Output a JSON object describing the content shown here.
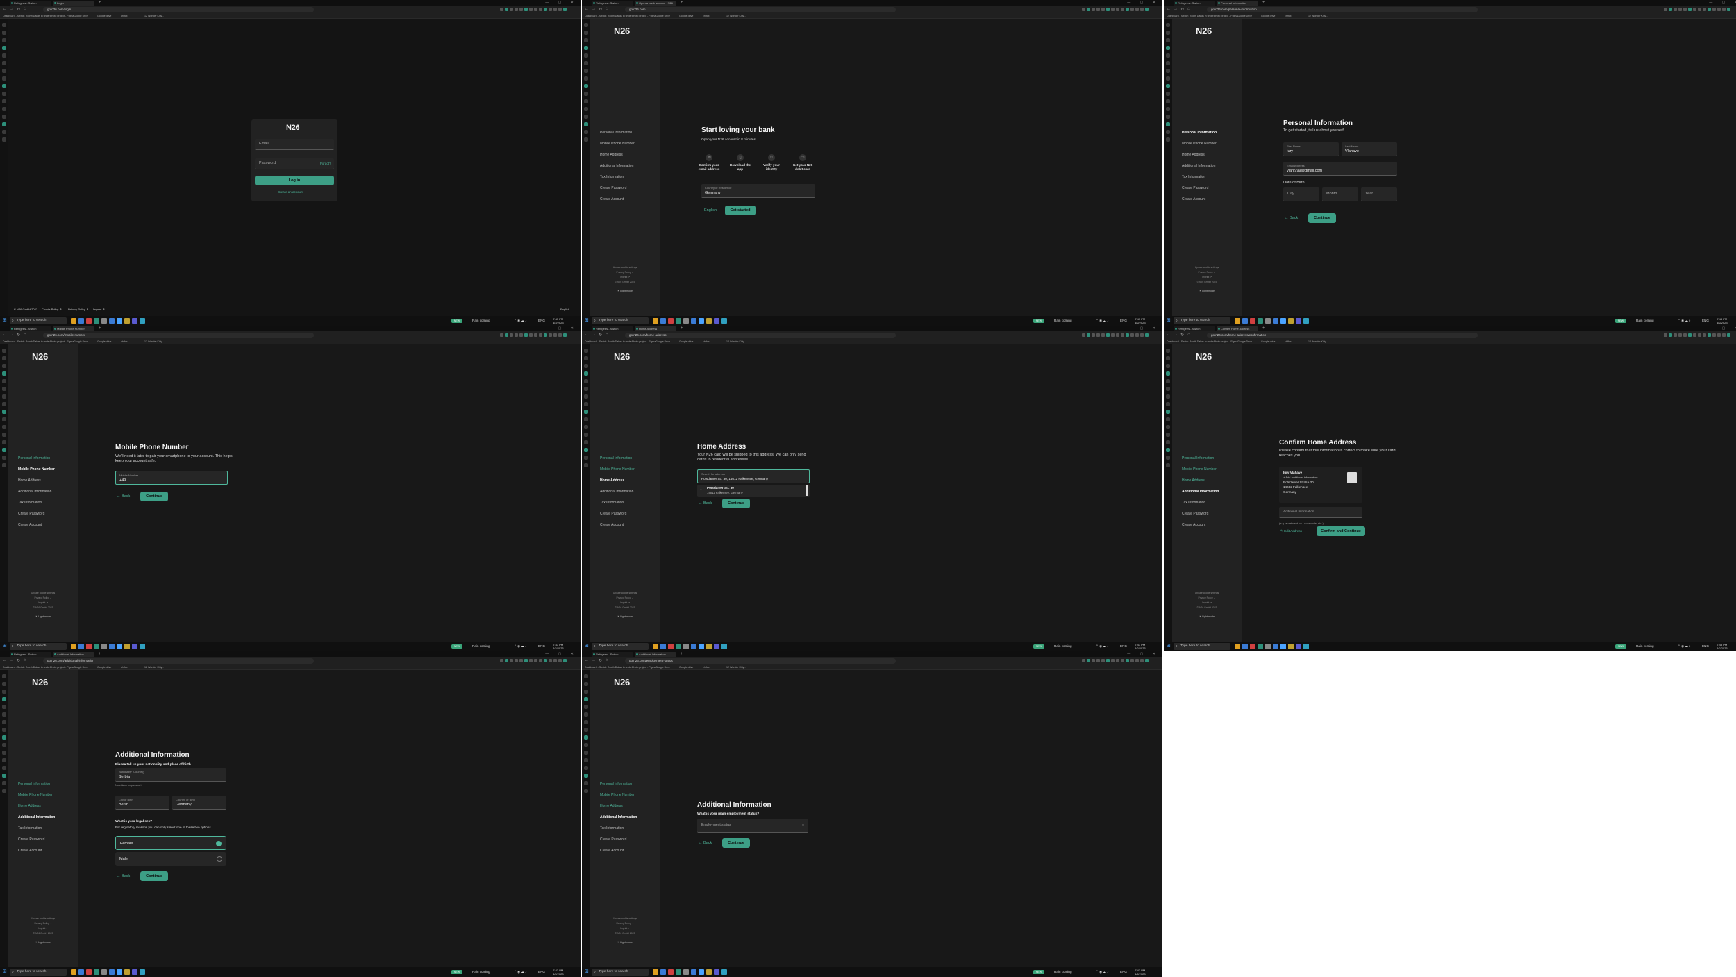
{
  "common": {
    "logo": "N26",
    "taskbar": {
      "search_placeholder": "Type here to search",
      "weather": "Rain coming",
      "time": "7:43 PM",
      "date": "4/2/2023",
      "lang": "ENG",
      "badge": "NEW"
    },
    "sidebar_footer": [
      "Update cookie settings",
      "Privacy Policy ↗",
      "Imprint ↗",
      "© N26 GmbH 2023"
    ],
    "light_mode": "☀ Light mode",
    "steps": [
      "Personal Information",
      "Mobile Phone Number",
      "Home Address",
      "Additional Information",
      "Tax Information",
      "Create Password",
      "Create Account"
    ],
    "bookmarks": [
      "Dashboard - Switch",
      "North Dallas in under...",
      "Photo project - Figma...",
      "Google Drive",
      "Google drive",
      "chffox",
      "12 Wonder Kitty..."
    ],
    "back_label": "← Back",
    "continue_label": "Continue"
  },
  "screens": [
    {
      "url": "go.n26.com/login",
      "tabs": [
        "Refugees - Switch",
        "Login"
      ],
      "login": {
        "email_placeholder": "Email",
        "password_placeholder": "Password",
        "forgot": "Forgot?",
        "login_button": "Log in",
        "create_account": "Create an account"
      },
      "footer": {
        "copyright": "© N26 GmbH 2023",
        "cookie": "Cookie Policy ↗",
        "privacy": "Privacy Policy ↗",
        "imprint": "Imprint ↗",
        "lang": "English"
      }
    },
    {
      "url": "go.n26.com",
      "tabs": [
        "Refugees - Switch",
        "Open a bank account · N26"
      ],
      "title": "Start loving your bank",
      "subtitle": "Open your N26 account in 8 minutes",
      "steps_icons": [
        {
          "icon": "✉",
          "label": "Confirm your email address"
        },
        {
          "icon": "▯",
          "label": "Download the app"
        },
        {
          "icon": "☺",
          "label": "Verify your identity"
        },
        {
          "icon": "▭",
          "label": "Get your N26 debit card"
        }
      ],
      "country_label": "Country of Residence",
      "country_value": "Germany",
      "lang_link": "English",
      "get_started": "Get started"
    },
    {
      "url": "go.n26.com/personal-information",
      "tabs": [
        "Refugees - Switch",
        "Personal Information"
      ],
      "title": "Personal Information",
      "subtitle": "To get started, tell us about yourself.",
      "first_name_label": "First Name",
      "first_name": "Iury",
      "last_name_label": "Last Name",
      "last_name": "Vlahave",
      "email_label": "Email Address",
      "email": "vlahl999@gmail.com",
      "dob_label": "Date of Birth",
      "day_ph": "Day",
      "month_ph": "Month",
      "year_ph": "Year"
    },
    {
      "url": "go.n26.com/mobile-number",
      "tabs": [
        "Refugees - Switch",
        "Mobile Phone Number"
      ],
      "title": "Mobile Phone Number",
      "subtitle": "We'll need it later to pair your smartphone to your account. This helps keep your account safe.",
      "phone_label": "Mobile Number",
      "phone_value": "+49"
    },
    {
      "url": "go.n26.com/home-address",
      "tabs": [
        "Refugees - Switch",
        "Home Address"
      ],
      "title": "Home Address",
      "subtitle": "Your N26 card will be shipped to this address. We can only send cards to residential addresses.",
      "search_label": "Search for address",
      "search_value": "Potsdamer Str. 30, 14612 Falkensee, Germany",
      "suggest_main": "Potsdamer Str. 30",
      "suggest_sub": "14612 Falkensee, Germany"
    },
    {
      "url": "go.n26.com/home-address/confirmation",
      "tabs": [
        "Refugees - Switch",
        "Confirm Home Address"
      ],
      "title": "Confirm Home Address",
      "subtitle": "Please confirm that this information is correct to make sure your card reaches you.",
      "card_name": "Iury Vlahave",
      "card_add": "+ Add additional information",
      "card_street": "Potsdamer Straße 30",
      "card_city": "14612 Falkensee",
      "card_country": "Germany",
      "addl_ph": "Additional Information",
      "addl_note": "(e.g. apartment no., door code, etc.)",
      "edit_address": "✎ Edit Address",
      "confirm_button": "Confirm and Continue"
    },
    {
      "url": "go.n26.com/additional-information",
      "tabs": [
        "Refugees - Switch",
        "Additional Information"
      ],
      "title": "Additional Information",
      "question": "Please tell us your nationality and place of birth.",
      "nationality_label": "Nationality (Country)",
      "nationality": "Serbia",
      "nationality_note": "No citizen on passport",
      "city_label": "City of Birth",
      "city": "Berlin",
      "country_label": "Country of Birth",
      "country": "Germany",
      "sex_q": "What is your legal sex?",
      "sex_note": "For regulatory reasons you can only select one of these two options.",
      "opt_female": "Female",
      "opt_male": "Male"
    },
    {
      "url": "go.n26.com/employment-status",
      "tabs": [
        "Refugees - Switch",
        "Additional Information"
      ],
      "title": "Additional Information",
      "question": "What is your main employment status?",
      "select_ph": "Employment status"
    }
  ]
}
